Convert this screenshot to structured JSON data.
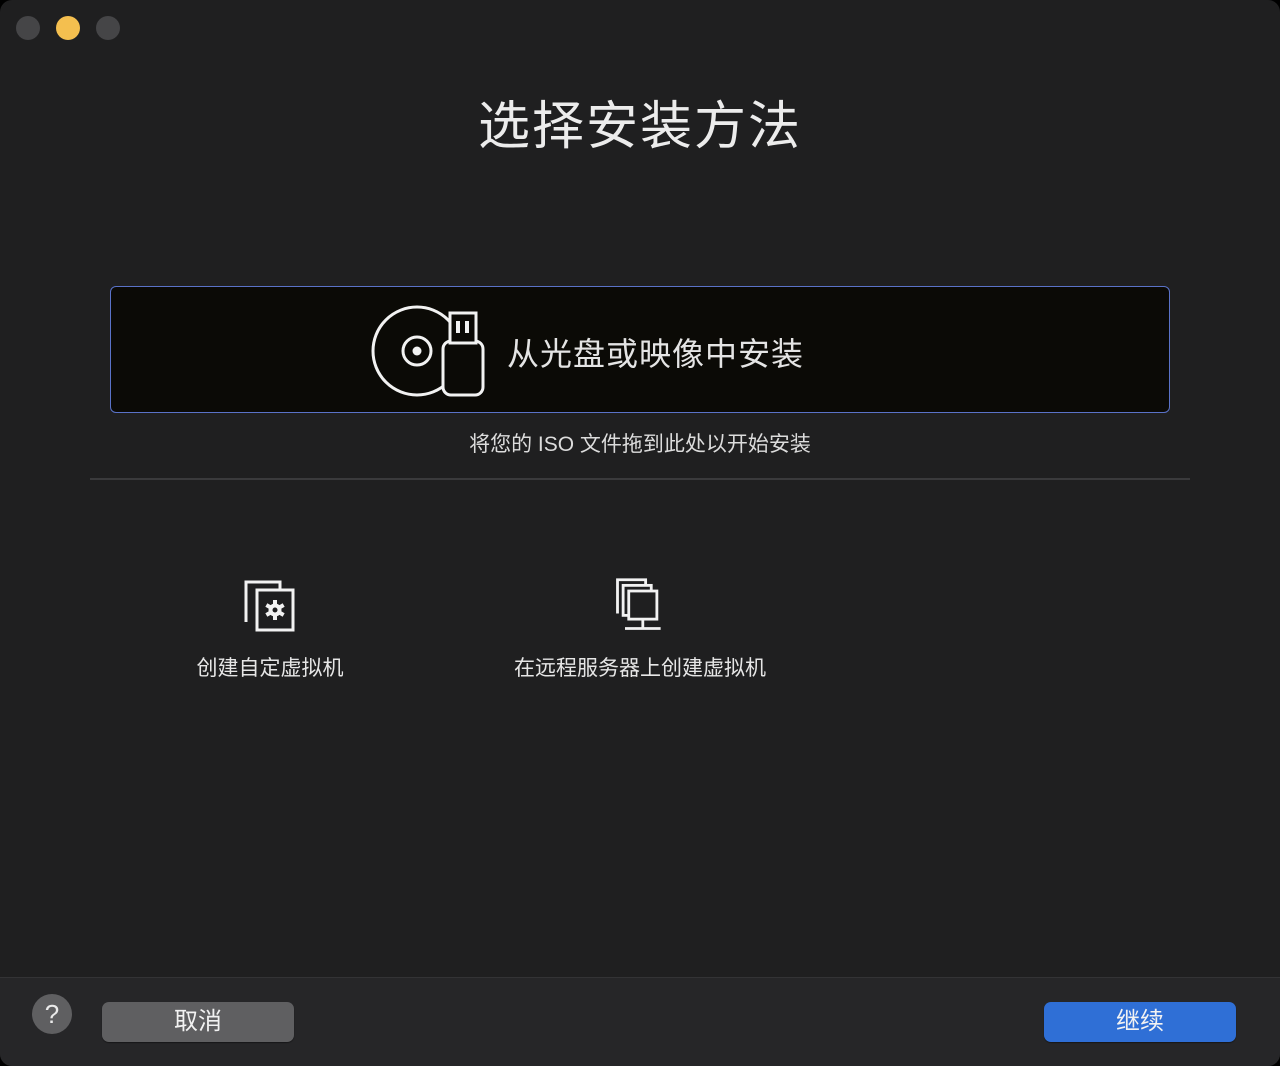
{
  "window": {
    "title": "选择安装方法"
  },
  "drop_zone": {
    "label": "从光盘或映像中安装",
    "hint": "将您的 ISO 文件拖到此处以开始安装",
    "icon": "disc-usb-icon"
  },
  "options": [
    {
      "label": "创建自定虚拟机",
      "icon": "custom-vm-gear-icon"
    },
    {
      "label": "在远程服务器上创建虚拟机",
      "icon": "remote-server-icon"
    }
  ],
  "footer": {
    "help_label": "?",
    "cancel_label": "取消",
    "continue_label": "继续"
  },
  "colors": {
    "background": "#1f1f20",
    "accent": "#2f6fd6",
    "drop_zone_border": "#5a72c8",
    "traffic_min": "#f4bf4f"
  }
}
